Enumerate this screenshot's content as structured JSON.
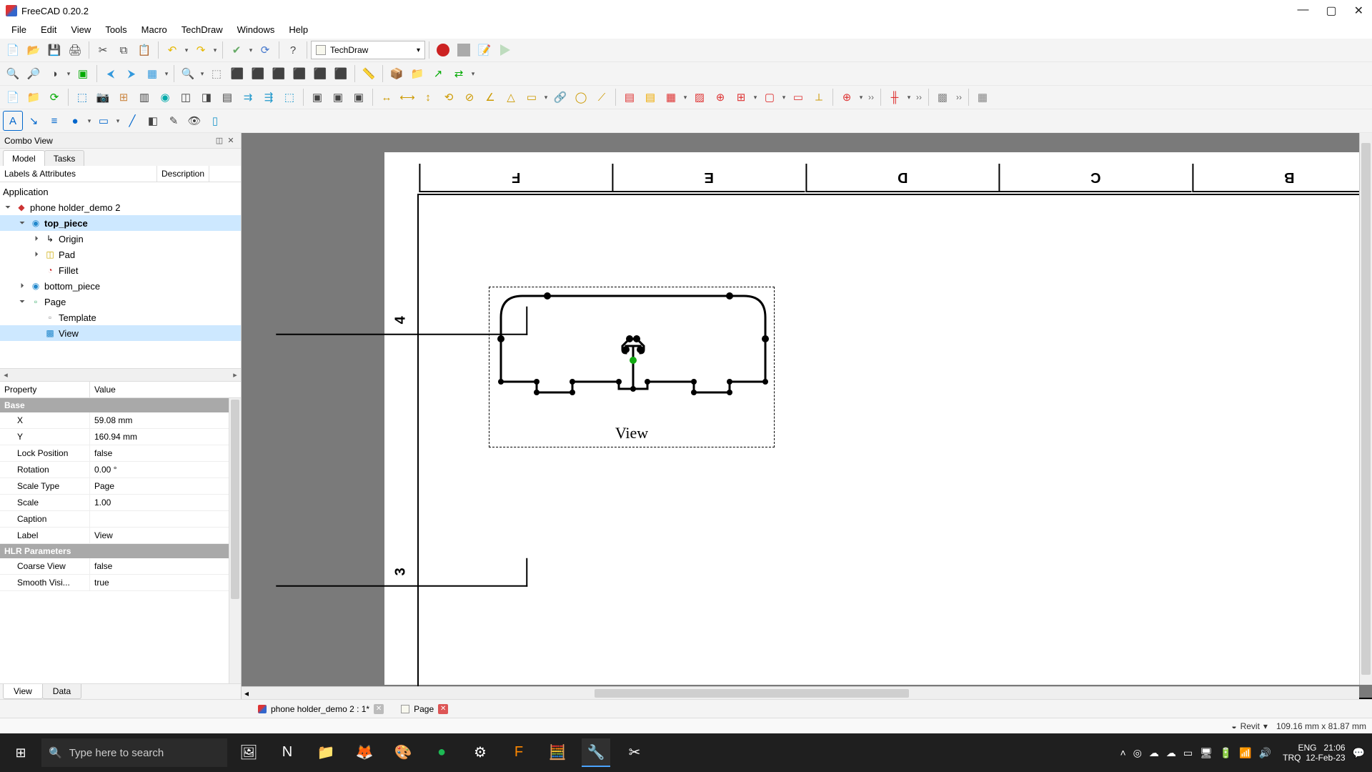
{
  "window": {
    "title": "FreeCAD 0.20.2"
  },
  "menu": [
    "File",
    "Edit",
    "View",
    "Tools",
    "Macro",
    "TechDraw",
    "Windows",
    "Help"
  ],
  "workbench": "TechDraw",
  "combo": {
    "title": "Combo View",
    "tabs": {
      "model": "Model",
      "tasks": "Tasks"
    },
    "header": {
      "labels": "Labels & Attributes",
      "desc": "Description"
    },
    "app": "Application",
    "tree": {
      "doc": "phone holder_demo 2",
      "top": "top_piece",
      "origin": "Origin",
      "pad": "Pad",
      "fillet": "Fillet",
      "bottom": "bottom_piece",
      "page": "Page",
      "template": "Template",
      "view": "View"
    }
  },
  "props": {
    "header": {
      "property": "Property",
      "value": "Value"
    },
    "section_base": "Base",
    "rows": {
      "x": {
        "k": "X",
        "v": "59.08 mm"
      },
      "y": {
        "k": "Y",
        "v": "160.94 mm"
      },
      "lock": {
        "k": "Lock Position",
        "v": "false"
      },
      "rotation": {
        "k": "Rotation",
        "v": "0.00 °"
      },
      "scale_type": {
        "k": "Scale Type",
        "v": "Page"
      },
      "scale": {
        "k": "Scale",
        "v": "1.00"
      },
      "caption": {
        "k": "Caption",
        "v": ""
      },
      "label": {
        "k": "Label",
        "v": "View"
      }
    },
    "section_hlr": "HLR Parameters",
    "hlr_rows": {
      "coarse": {
        "k": "Coarse View",
        "v": "false"
      },
      "smooth": {
        "k": "Smooth Visi...",
        "v": "true"
      }
    },
    "bottom_tabs": {
      "view": "View",
      "data": "Data"
    }
  },
  "drawing": {
    "cols": [
      "F",
      "E",
      "D",
      "C",
      "B"
    ],
    "rows": [
      "4",
      "3"
    ],
    "view_caption": "View"
  },
  "doc_tabs": {
    "main": "phone holder_demo 2 : 1*",
    "page": "Page"
  },
  "status": {
    "group1": "Revit",
    "coords": "109.16 mm x 81.87 mm"
  },
  "taskbar": {
    "search_placeholder": "Type here to search",
    "lang1": "ENG",
    "lang2": "TRQ",
    "time": "21:06",
    "date": "12-Feb-23"
  }
}
